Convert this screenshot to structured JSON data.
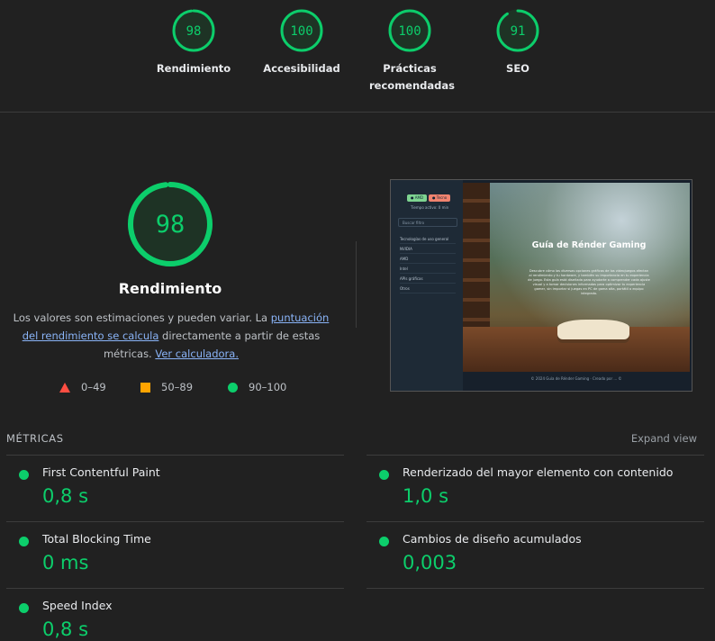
{
  "colors": {
    "pass": "#0cce6b",
    "average": "#ffa400",
    "fail": "#ff4e42",
    "background": "#212121"
  },
  "top_gauges": [
    {
      "score": "98",
      "value": 0.98,
      "label": "Rendimiento"
    },
    {
      "score": "100",
      "value": 1.0,
      "label": "Accesibilidad"
    },
    {
      "score": "100",
      "value": 1.0,
      "label": "Prácticas recomendadas"
    },
    {
      "score": "91",
      "value": 0.91,
      "label": "SEO"
    }
  ],
  "performance": {
    "score": "98",
    "value": 0.98,
    "title": "Rendimiento",
    "desc_text_1": "Los valores son estimaciones y pueden variar. La ",
    "desc_link_1": "puntuación del rendimiento se calcula",
    "desc_text_2": " directamente a partir de estas métricas. ",
    "desc_link_2": "Ver calculadora."
  },
  "legend": [
    {
      "icon": "triangle",
      "range": "0–49"
    },
    {
      "icon": "square",
      "range": "50–89"
    },
    {
      "icon": "circle",
      "range": "90–100"
    }
  ],
  "screenshot": {
    "btn_active": "● AMD",
    "btn_other": "● Tecno",
    "time_label": "Tiempo activo: 0 min",
    "search_placeholder": "Buscar filtro",
    "menu": [
      "Tecnologías de uso general",
      "NVIDIA",
      "AMD",
      "Intel",
      "APIs gráficas",
      "Otros"
    ],
    "title": "Guía de Rénder Gaming",
    "text": "Descubre cómo las diversas opciones gráficas de los videojuegos afectan al rendimiento y tu hardware, y también su importancia en tu experiencia de juego. Esta guía está diseñada para ayudarte a comprender cada ajuste visual y a tomar decisiones informadas para optimizar tu experiencia gamer, sin importar si juegas en PC de gama alta, portátil o equipo integrado.",
    "footer": "© 2024 Guía de Rénder Gaming · Creado por ... ©"
  },
  "metrics": {
    "header": "MÉTRICAS",
    "expand_label": "Expand view",
    "items": [
      {
        "label": "First Contentful Paint",
        "value": "0,8 s"
      },
      {
        "label": "Renderizado del mayor elemento con contenido",
        "value": "1,0 s"
      },
      {
        "label": "Total Blocking Time",
        "value": "0 ms"
      },
      {
        "label": "Cambios de diseño acumulados",
        "value": "0,003"
      },
      {
        "label": "Speed Index",
        "value": "0,8 s"
      }
    ]
  }
}
